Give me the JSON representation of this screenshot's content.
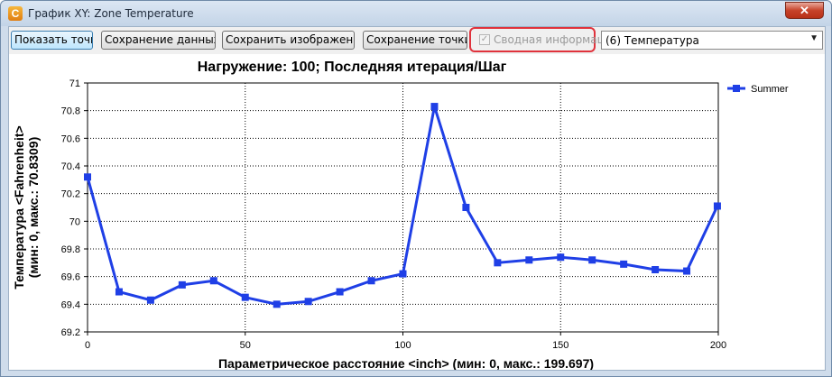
{
  "window": {
    "title": "График XY: Zone Temperature",
    "app_icon_letter": "C",
    "close_glyph": "✕"
  },
  "toolbar": {
    "show_points": "Показать точки",
    "save_data": "Сохранение данных...",
    "save_image": "Сохранить изображение...",
    "save_points": "Сохранение точки...",
    "summary_check": "✓",
    "summary_label": "Сводная информация",
    "variable_select": "(6) Температура",
    "select_arrow": "▼"
  },
  "colors": {
    "series": "#1f3fe6",
    "grid": "#000000"
  },
  "chart_data": {
    "type": "line",
    "title": "Нагружение: 100; Последняя итерация/Шаг",
    "xlabel": "Параметрическое расстояние <inch> (мин: 0, макс.: 199.697)",
    "ylabel_line1": "Температура <Fahrenheit>",
    "ylabel_line2": "(мин: 0, макс.: 70.8309)",
    "xlim": [
      0,
      200
    ],
    "ylim": [
      69.2,
      71
    ],
    "x_ticks": [
      0,
      50,
      100,
      150,
      200
    ],
    "y_ticks": [
      69.2,
      69.4,
      69.6,
      69.8,
      70,
      70.2,
      70.4,
      70.6,
      70.8,
      71
    ],
    "x_tick_labels": [
      "0",
      "50",
      "100",
      "150",
      "200"
    ],
    "y_tick_labels": [
      "69.2",
      "69.4",
      "69.6",
      "69.8",
      "70",
      "70.2",
      "70.4",
      "70.6",
      "70.8",
      "71"
    ],
    "grid": true,
    "legend_position": "top-right",
    "series": [
      {
        "name": "Summer",
        "x": [
          0,
          10,
          20,
          30,
          40,
          50,
          60,
          70,
          80,
          90,
          100,
          110,
          120,
          130,
          140,
          150,
          160,
          170,
          180,
          190,
          199.697
        ],
        "y": [
          70.32,
          69.49,
          69.43,
          69.54,
          69.57,
          69.45,
          69.4,
          69.42,
          69.49,
          69.57,
          69.62,
          70.83,
          70.1,
          69.7,
          69.72,
          69.74,
          69.72,
          69.69,
          69.65,
          69.64,
          70.11
        ]
      }
    ]
  }
}
